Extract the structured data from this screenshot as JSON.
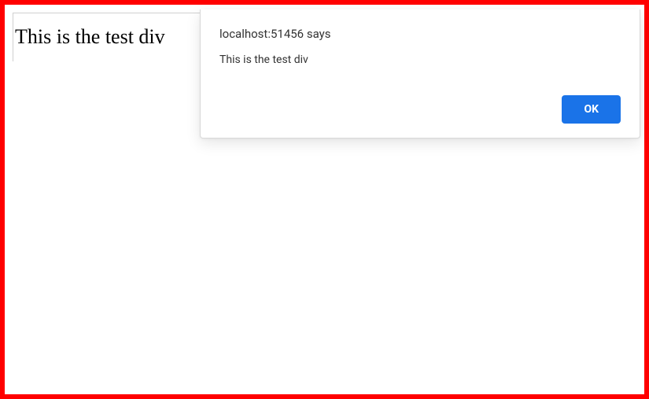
{
  "page": {
    "test_div_text": "This is the test div"
  },
  "dialog": {
    "origin": "localhost:51456 says",
    "message": "This is the test div",
    "ok_label": "OK"
  }
}
